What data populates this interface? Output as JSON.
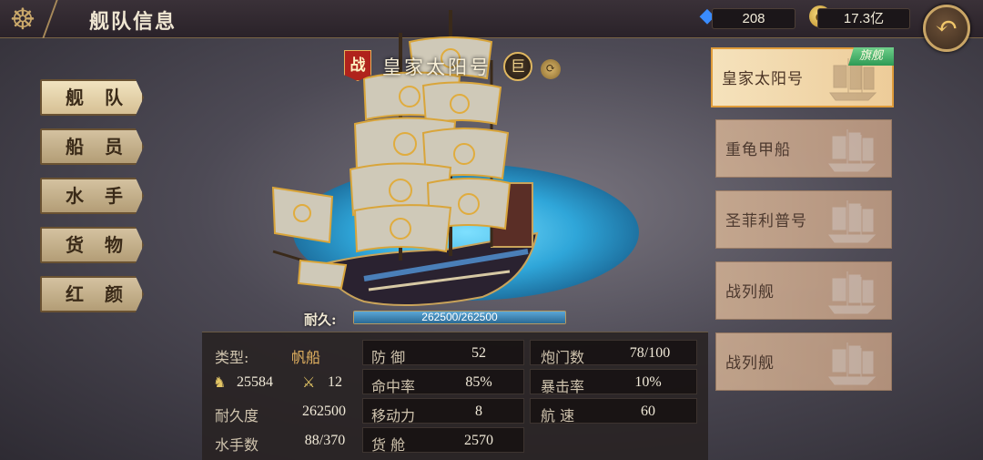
{
  "header": {
    "title": "舰队信息",
    "gems": "208",
    "gold": "17.3亿",
    "icons": {
      "menu": "helm-icon",
      "gem": "blue-gem-icon",
      "coin": "gold-coin-icon",
      "back": "back-arrow-icon"
    }
  },
  "nav": {
    "items": [
      {
        "label": "舰 队",
        "active": true
      },
      {
        "label": "船 员",
        "active": false
      },
      {
        "label": "水 手",
        "active": false
      },
      {
        "label": "货 物",
        "active": false
      },
      {
        "label": "红 颜",
        "active": false
      }
    ]
  },
  "ship": {
    "battle_badge": "战",
    "name": "皇家太阳号",
    "size_badge": "巨",
    "durability_label": "耐久:",
    "durability_text": "262500/262500",
    "durability_fraction": 1.0
  },
  "stats": {
    "type_label": "类型:",
    "type_value": "帆船",
    "cargo_icon_value": "25584",
    "swords_icon_value": "12",
    "durability_label": "耐久度",
    "durability_value": "262500",
    "sailors_label": "水手数",
    "sailors_value": "88/370",
    "defense_label": "防 御",
    "defense_value": "52",
    "accuracy_label": "命中率",
    "accuracy_value": "85%",
    "mobility_label": "移动力",
    "mobility_value": "8",
    "hold_label": "货 舱",
    "hold_value": "2570",
    "gunports_label": "炮门数",
    "gunports_value": "78/100",
    "crit_label": "暴击率",
    "crit_value": "10%",
    "speed_label": "航 速",
    "speed_value": "60"
  },
  "ship_list": [
    {
      "name": "皇家太阳号",
      "flag": "旗舰",
      "active": true
    },
    {
      "name": "重龟甲船",
      "active": false
    },
    {
      "name": "圣菲利普号",
      "active": false
    },
    {
      "name": "战列舰",
      "active": false
    },
    {
      "name": "战列舰",
      "active": false
    }
  ]
}
